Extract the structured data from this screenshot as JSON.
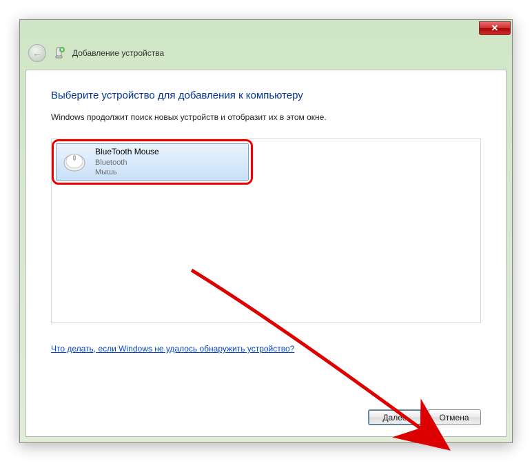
{
  "titlebar": {
    "close_glyph": "✕"
  },
  "navbar": {
    "back_glyph": "←",
    "wizard_title": "Добавление устройства"
  },
  "main": {
    "heading": "Выберите устройство для добавления к компьютеру",
    "subtext": "Windows продолжит поиск новых устройств и отобразит их в этом окне."
  },
  "device_list": {
    "items": [
      {
        "name": "BlueTooth Mouse",
        "protocol": "Bluetooth",
        "type": "Мышь"
      }
    ]
  },
  "help_link": "Что делать, если Windows не удалось обнаружить устройство?",
  "buttons": {
    "next": "Далее",
    "cancel": "Отмена"
  }
}
